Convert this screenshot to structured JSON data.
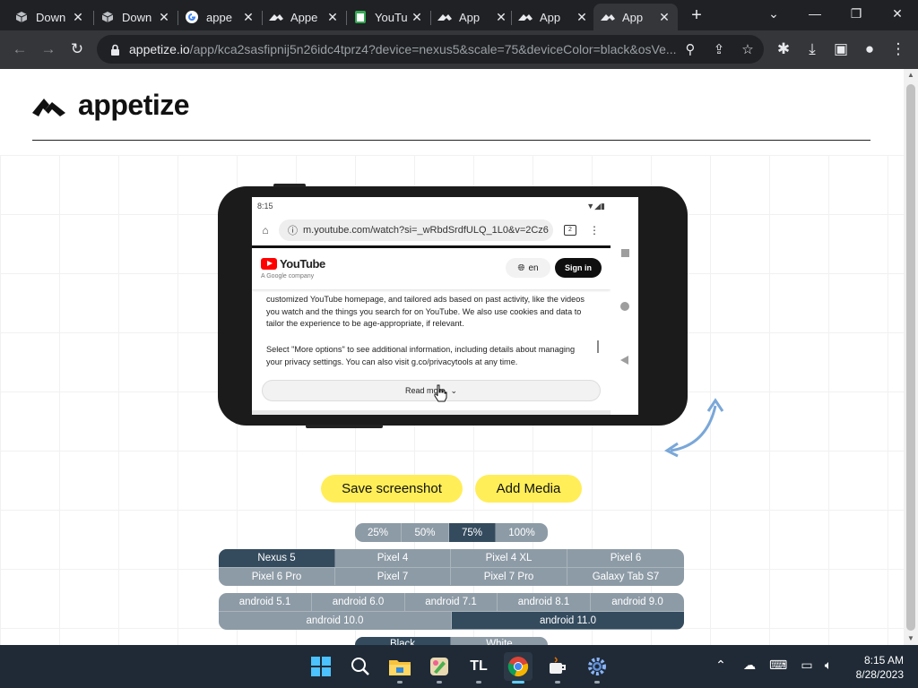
{
  "browser": {
    "tabs": [
      {
        "title": "Down",
        "icon": "cube-icon"
      },
      {
        "title": "Down",
        "icon": "cube-icon"
      },
      {
        "title": "appe",
        "icon": "google-icon"
      },
      {
        "title": "Appe",
        "icon": "appetize-icon"
      },
      {
        "title": "YouTu",
        "icon": "youtube-icon"
      },
      {
        "title": "App",
        "icon": "appetize-icon"
      },
      {
        "title": "App",
        "icon": "appetize-icon"
      },
      {
        "title": "App",
        "icon": "appetize-icon",
        "active": true
      }
    ],
    "url_host": "appetize.io",
    "url_path": "/app/kca2sasfipnij5n26idc4tprz4?device=nexus5&scale=75&deviceColor=black&osVe..."
  },
  "brand": {
    "name": "appetize"
  },
  "emulator": {
    "status_time": "8:15",
    "mobile_url": "m.youtube.com/watch?si=_wRbdSrdfULQ_1L0&v=2Cz6",
    "tab_count": "2",
    "yt_logo_text": "YouTube",
    "yt_sub": "A Google company",
    "lang_label": "en",
    "signin_label": "Sign in",
    "para1": "customized YouTube homepage, and tailored ads based on past activity, like the videos you watch and the things you search for on YouTube. We also use cookies and data to tailor the experience to be age-appropriate, if relevant.",
    "para2": "Select \"More options\" to see additional information, including details about managing your privacy settings. You can also visit g.co/privacytools at any time.",
    "read_more": "Read more"
  },
  "actions": {
    "save_screenshot": "Save screenshot",
    "add_media": "Add Media"
  },
  "scales": [
    "25%",
    "50%",
    "75%",
    "100%"
  ],
  "scale_selected": "75%",
  "devices": [
    [
      "Nexus 5",
      "Pixel 4",
      "Pixel 4 XL",
      "Pixel 6"
    ],
    [
      "Pixel 6 Pro",
      "Pixel 7",
      "Pixel 7 Pro",
      "Galaxy Tab S7"
    ]
  ],
  "device_selected": "Nexus 5",
  "os_versions": [
    [
      "android 5.1",
      "android 6.0",
      "android 7.1",
      "android 8.1",
      "android 9.0"
    ],
    [
      "android 10.0",
      "android 11.0"
    ]
  ],
  "os_selected": "android 11.0",
  "colors_partial": [
    "Black",
    "White"
  ],
  "taskbar": {
    "time": "8:15 AM",
    "date": "8/28/2023",
    "apps": [
      "windows-start-icon",
      "search-icon",
      "file-explorer-icon",
      "paint-icon",
      "tl-app-icon",
      "chrome-icon",
      "java-icon",
      "settings-icon"
    ]
  },
  "theme": {
    "accent_yellow": "#ffee58",
    "seg_selected": "#344b5e",
    "seg_normal": "#8d9ba6"
  }
}
